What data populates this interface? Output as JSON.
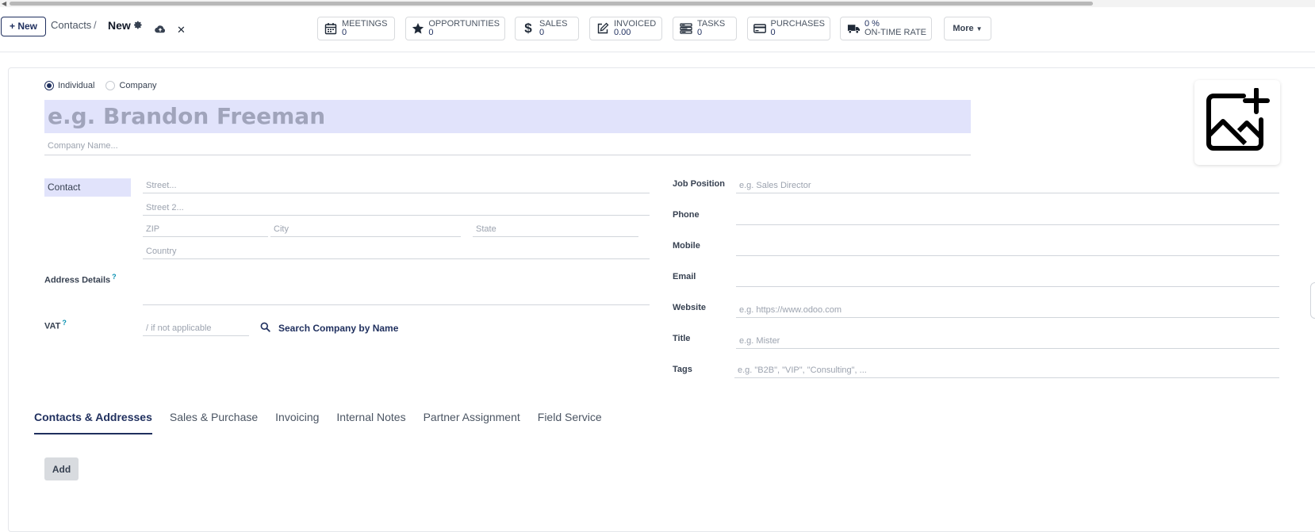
{
  "control_panel": {
    "new_label": "+ New",
    "breadcrumb_parent": "Contacts",
    "breadcrumb_sep": "/",
    "breadcrumb_current": "New",
    "smart_buttons": [
      {
        "label": "MEETINGS",
        "value": "0",
        "icon": "calendar-icon"
      },
      {
        "label": "OPPORTUNITIES",
        "value": "0",
        "icon": "star-icon"
      },
      {
        "label": "SALES",
        "value": "0",
        "icon": "dollar-icon"
      },
      {
        "label": "INVOICED",
        "value": "0.00",
        "icon": "pencil-square-icon"
      },
      {
        "label": "TASKS",
        "value": "0",
        "icon": "tasks-icon"
      },
      {
        "label": "PURCHASES",
        "value": "0",
        "icon": "credit-card-icon"
      },
      {
        "label": "ON-TIME RATE",
        "value": "0 %",
        "icon": "truck-icon"
      }
    ],
    "more_label": "More"
  },
  "form": {
    "type_individual": "Individual",
    "type_company": "Company",
    "selected_type": "Individual",
    "name_placeholder": "e.g. Brandon Freeman",
    "company_placeholder": "Company Name...",
    "address_type": "Contact",
    "street_placeholder": "Street...",
    "street2_placeholder": "Street 2...",
    "zip_placeholder": "ZIP",
    "city_placeholder": "City",
    "state_placeholder": "State",
    "country_placeholder": "Country",
    "address_details_label": "Address Details",
    "vat_label": "VAT",
    "help_mark": "?",
    "vat_placeholder": "/ if not applicable",
    "search_company_label": "Search Company by Name",
    "job_position_label": "Job Position",
    "job_position_placeholder": "e.g. Sales Director",
    "phone_label": "Phone",
    "mobile_label": "Mobile",
    "email_label": "Email",
    "website_label": "Website",
    "website_placeholder": "e.g. https://www.odoo.com",
    "title_label": "Title",
    "title_placeholder": "e.g. Mister",
    "tags_label": "Tags",
    "tags_placeholder": "e.g. \"B2B\", \"VIP\", \"Consulting\", ..."
  },
  "notebook": {
    "tabs": [
      "Contacts & Addresses",
      "Sales & Purchase",
      "Invoicing",
      "Internal Notes",
      "Partner Assignment",
      "Field Service"
    ],
    "active_tab": "Contacts & Addresses",
    "add_label": "Add"
  },
  "colors": {
    "brand": "#1f2f5e",
    "highlight": "#e1e3fb"
  }
}
